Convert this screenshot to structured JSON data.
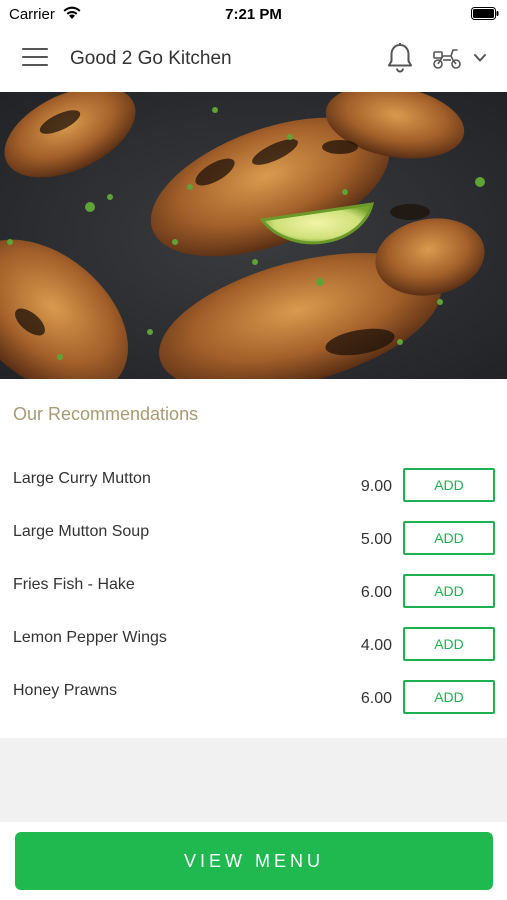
{
  "status_bar": {
    "carrier": "Carrier",
    "time": "7:21 PM"
  },
  "header": {
    "title": "Good 2 Go Kitchen",
    "icons": [
      "menu-icon",
      "bell-icon",
      "scooter-icon",
      "chevron-down-icon"
    ]
  },
  "hero": {
    "image": "grilled-chicken-drumsticks-with-lime"
  },
  "recommendations": {
    "title": "Our Recommendations",
    "items": [
      {
        "name": "Large Curry Mutton",
        "price": "9.00",
        "button": "ADD"
      },
      {
        "name": "Large Mutton Soup",
        "price": "5.00",
        "button": "ADD"
      },
      {
        "name": "Fries Fish - Hake",
        "price": "6.00",
        "button": "ADD"
      },
      {
        "name": "Lemon Pepper Wings",
        "price": "4.00",
        "button": "ADD"
      },
      {
        "name": "Honey Prawns",
        "price": "6.00",
        "button": "ADD"
      }
    ]
  },
  "footer": {
    "button_label": "VIEW MENU"
  },
  "colors": {
    "accent_green": "#1fb950",
    "section_title": "#a89a72",
    "background_grey": "#f1f1f1"
  }
}
